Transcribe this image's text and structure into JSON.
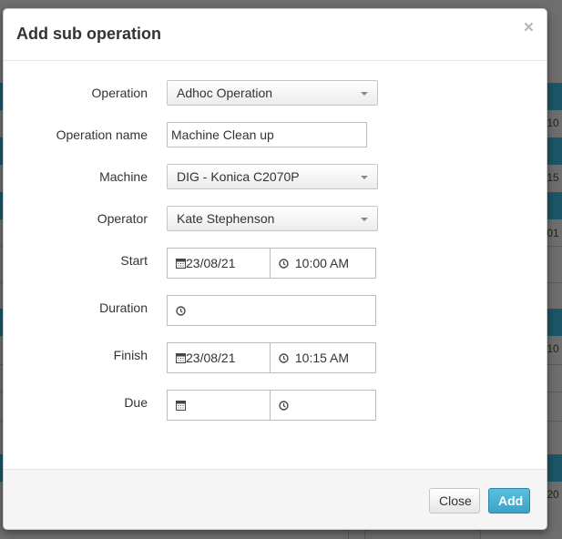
{
  "background": {
    "row_fragments": [
      ":10",
      ":15",
      ":01",
      ":10",
      ":20"
    ]
  },
  "modal": {
    "title": "Add sub operation",
    "close_icon": "×",
    "fields": {
      "operation": {
        "label": "Operation",
        "value": "Adhoc Operation"
      },
      "operation_name": {
        "label": "Operation name",
        "value": "Machine Clean up"
      },
      "machine": {
        "label": "Machine",
        "value": "DIG - Konica C2070P"
      },
      "operator": {
        "label": "Operator",
        "value": "Kate Stephenson"
      },
      "start": {
        "label": "Start",
        "date": "23/08/21",
        "time": "10:00 AM"
      },
      "duration": {
        "label": "Duration",
        "value": ""
      },
      "finish": {
        "label": "Finish",
        "date": "23/08/21",
        "time": "10:15 AM"
      },
      "due": {
        "label": "Due",
        "date": "",
        "time": ""
      }
    },
    "footer": {
      "close_label": "Close",
      "add_label": "Add"
    }
  },
  "icons": {
    "date": "calendar-icon",
    "time": "clock-icon",
    "select": "caret-down-icon"
  },
  "colors": {
    "primary_button": "#3fa9cf",
    "background_header": "#1c5566"
  }
}
